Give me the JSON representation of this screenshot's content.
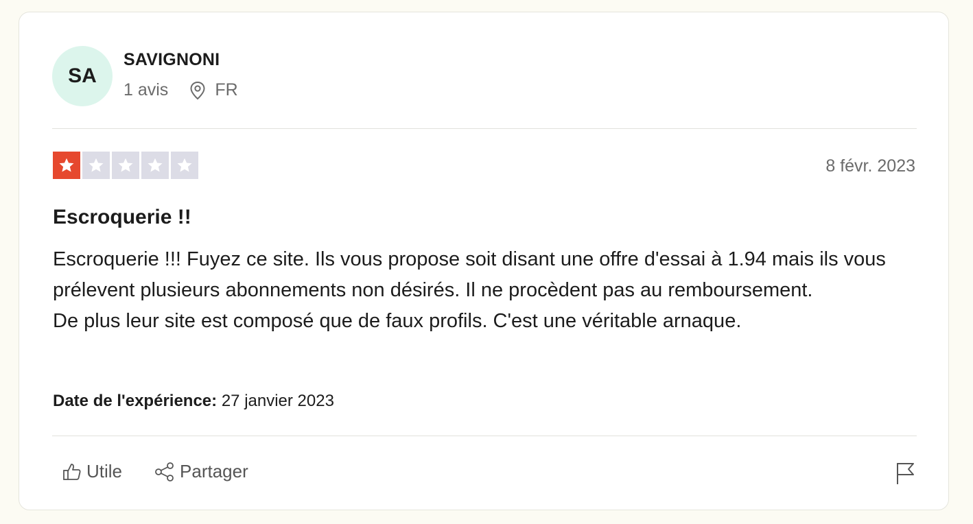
{
  "reviewer": {
    "initials": "SA",
    "name": "SAVIGNONI",
    "reviews_count": "1 avis",
    "country": "FR"
  },
  "review": {
    "rating": 1,
    "max_rating": 5,
    "date": "8 févr. 2023",
    "title": "Escroquerie !!",
    "body": [
      "Escroquerie !!! Fuyez ce site. Ils vous propose soit disant une offre d'essai à 1.94 mais ils vous prélevent plusieurs abonnements non désirés. Il ne procèdent pas au remboursement.",
      "De plus leur site est composé que de faux profils. C'est une véritable arnaque."
    ],
    "experience_label": "Date de l'expérience:",
    "experience_date": "27 janvier 2023"
  },
  "actions": {
    "useful_label": "Utile",
    "share_label": "Partager"
  },
  "icons": {
    "location": "map-pin-icon",
    "useful": "thumbs-up-icon",
    "share": "share-icon",
    "report": "flag-icon",
    "star": "star-icon"
  },
  "colors": {
    "star_active": "#e6482e",
    "star_inactive": "#dcdce6",
    "avatar_bg": "#dcf5ec",
    "page_bg": "#fcfbf3"
  }
}
